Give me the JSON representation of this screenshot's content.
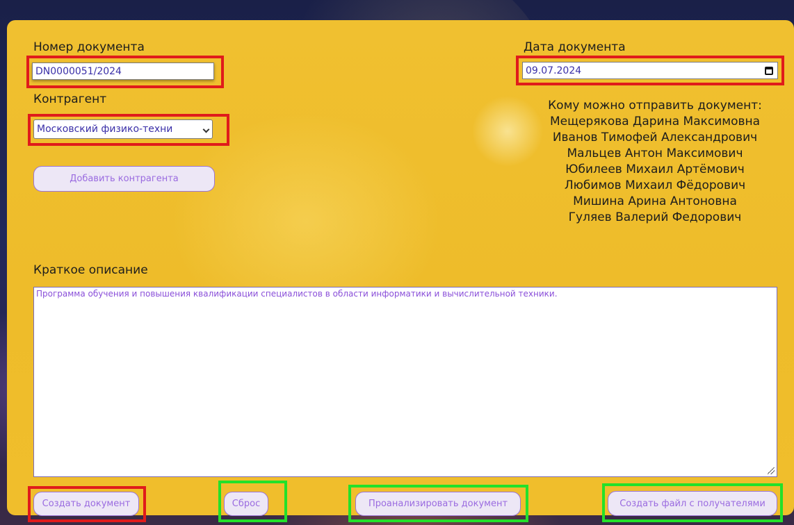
{
  "form": {
    "doc_number_label": "Номер документа",
    "doc_number_value": "DN0000051/2024",
    "doc_date_label": "Дата документа",
    "doc_date_value": "09.07.2024",
    "counterparty_label": "Контрагент",
    "counterparty_selected": "Московский физико-техни",
    "add_counterparty_button": "Добавить контрагента",
    "recipients_title": "Кому можно отправить документ:",
    "recipients": [
      "Мещерякова Дарина Максимовна",
      "Иванов Тимофей Александрович",
      "Мальцев Антон Максимович",
      "Юбилеев Михаил Артёмович",
      "Любимов Михаил Фёдорович",
      "Мишина Арина Антоновна",
      "Гуляев Валерий Федорович"
    ],
    "description_label": "Краткое описание",
    "description_value": "Программа обучения и повышения квалификации специалистов в области информатики и вычислительной техники."
  },
  "actions": {
    "create_document": "Создать документ",
    "reset": "Сброс",
    "analyze_document": "Проанализировать документ",
    "create_recipients_file": "Создать файл с получателями"
  },
  "colors": {
    "panel": "#efbe2c",
    "highlight_red": "#e01b1b",
    "highlight_green": "#23e12a",
    "button_text": "#9a6be0"
  }
}
